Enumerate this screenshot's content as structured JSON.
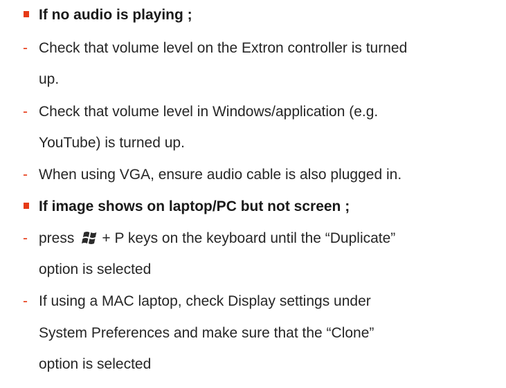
{
  "content": {
    "audio_heading": "If no audio is playing ;",
    "audio_1_l1": "Check that volume level on the Extron controller is turned",
    "audio_1_l2": "up.",
    "audio_2_l1": "Check that volume level in Windows/application (e.g.",
    "audio_2_l2": "YouTube) is turned up.",
    "audio_3": "When using VGA, ensure audio cable is also plugged in.",
    "image_heading": "If image shows on laptop/PC but not screen ;",
    "image_1_pre": "press",
    "image_1_post": "+ P keys on the keyboard until the “Duplicate”",
    "image_1_l2": "option is selected",
    "image_2_l1": "If using a MAC laptop, check Display settings under",
    "image_2_l2": "System Preferences and make sure that the “Clone”",
    "image_2_l3": "option is selected"
  },
  "bullet_marker": "-",
  "icons": {
    "windows_key": "windows-logo-icon"
  },
  "colors": {
    "accent": "#e63a16",
    "text": "#262626"
  }
}
